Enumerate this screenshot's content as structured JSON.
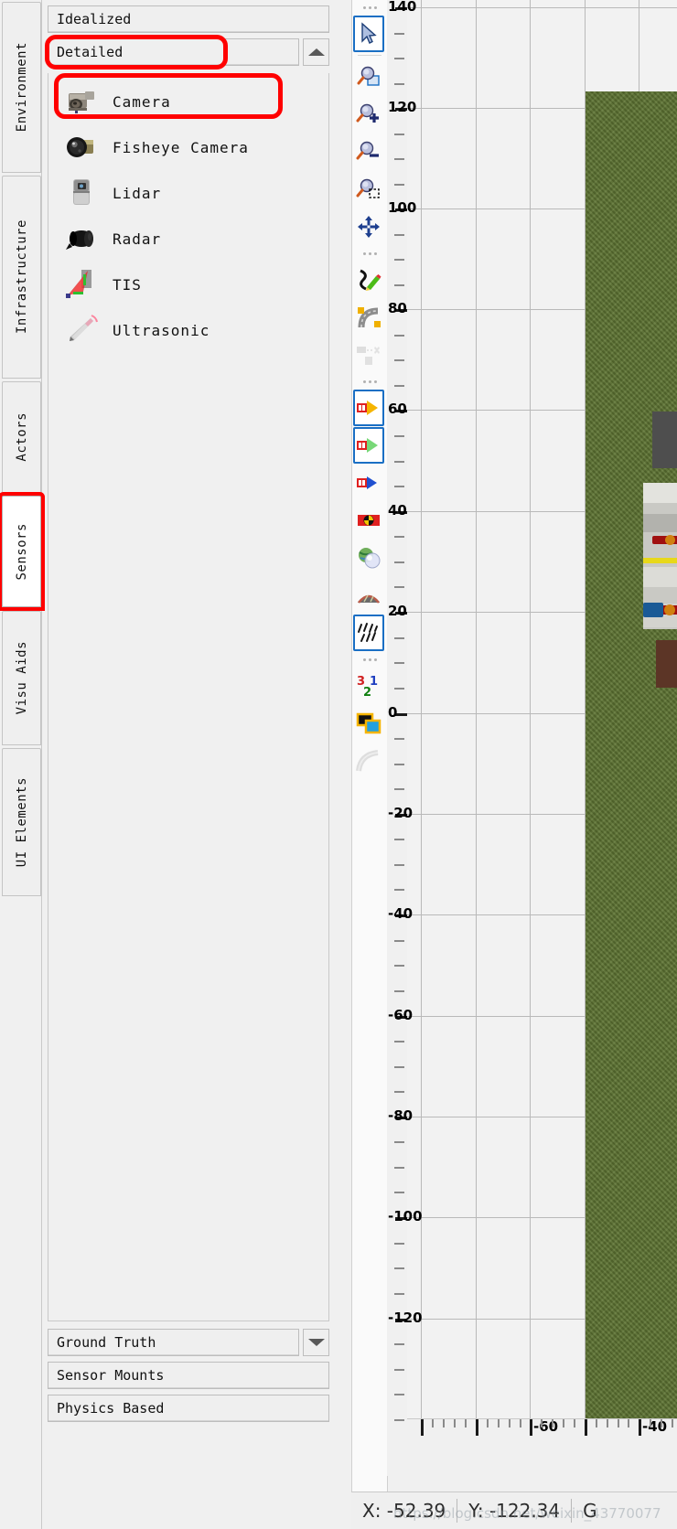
{
  "vertical_tabs": [
    {
      "label": "Environment",
      "selected": false,
      "highlighted": false
    },
    {
      "label": "Infrastructure",
      "selected": false,
      "highlighted": false
    },
    {
      "label": "Actors",
      "selected": false,
      "highlighted": false
    },
    {
      "label": "Sensors",
      "selected": true,
      "highlighted": true
    },
    {
      "label": "Visu Aids",
      "selected": false,
      "highlighted": false
    },
    {
      "label": "UI Elements",
      "selected": false,
      "highlighted": false
    }
  ],
  "panel": {
    "groups_top": [
      {
        "label": "Idealized",
        "has_arrow": false,
        "highlighted": false
      },
      {
        "label": "Detailed",
        "has_arrow": true,
        "arrow": "caret-up",
        "highlighted": true
      }
    ],
    "sensors": [
      {
        "label": "Camera",
        "icon": "camera-icon",
        "highlighted": true
      },
      {
        "label": "Fisheye Camera",
        "icon": "fisheye-camera-icon",
        "highlighted": false
      },
      {
        "label": "Lidar",
        "icon": "lidar-icon",
        "highlighted": false
      },
      {
        "label": "Radar",
        "icon": "radar-icon",
        "highlighted": false
      },
      {
        "label": "TIS",
        "icon": "tis-icon",
        "highlighted": false
      },
      {
        "label": "Ultrasonic",
        "icon": "ultrasonic-icon",
        "highlighted": false
      }
    ],
    "groups_bottom": [
      {
        "label": "Ground Truth",
        "has_arrow": true,
        "arrow": "caret-down"
      },
      {
        "label": "Sensor Mounts",
        "has_arrow": false
      },
      {
        "label": "Physics Based",
        "has_arrow": false
      }
    ]
  },
  "toolbar": {
    "groups": [
      {
        "grip": true,
        "items": [
          {
            "name": "select-cursor-tool",
            "selected": true,
            "enabled": true
          }
        ]
      },
      {
        "grip": false,
        "separator": true,
        "items": [
          {
            "name": "zoom-fit-tool",
            "selected": false,
            "enabled": true
          },
          {
            "name": "zoom-in-tool",
            "selected": false,
            "enabled": true
          },
          {
            "name": "zoom-out-tool",
            "selected": false,
            "enabled": true
          },
          {
            "name": "zoom-region-tool",
            "selected": false,
            "enabled": true
          },
          {
            "name": "pan-move-tool",
            "selected": false,
            "enabled": true
          }
        ]
      },
      {
        "grip": true,
        "items": [
          {
            "name": "draw-path-tool",
            "selected": false,
            "enabled": true
          },
          {
            "name": "road-curve-tool",
            "selected": false,
            "enabled": true
          },
          {
            "name": "object-delete-tool",
            "selected": false,
            "enabled": false
          }
        ]
      },
      {
        "grip": true,
        "items": [
          {
            "name": "sensor-frustum-yellow-toggle",
            "selected": true,
            "enabled": true
          },
          {
            "name": "sensor-frustum-green-toggle",
            "selected": true,
            "enabled": true
          },
          {
            "name": "sensor-frustum-blue-toggle",
            "selected": false,
            "enabled": true
          },
          {
            "name": "sensor-detection-toggle",
            "selected": false,
            "enabled": true
          },
          {
            "name": "environment-sphere-toggle",
            "selected": false,
            "enabled": true
          },
          {
            "name": "terrain-road-toggle",
            "selected": false,
            "enabled": true
          },
          {
            "name": "rain-effects-toggle",
            "selected": true,
            "enabled": true
          }
        ]
      },
      {
        "grip": true,
        "items": [
          {
            "name": "layer-order-tool",
            "selected": false,
            "enabled": true
          },
          {
            "name": "color-swap-tool",
            "selected": false,
            "enabled": true
          },
          {
            "name": "curve-radius-tool",
            "selected": false,
            "enabled": false
          }
        ]
      }
    ]
  },
  "canvas": {
    "y_axis_labels": [
      "140",
      "120",
      "100",
      "80",
      "60",
      "40",
      "20",
      "0",
      "-20",
      "-40",
      "-60",
      "-80",
      "-100",
      "-120"
    ],
    "x_axis_labels": [
      "-60",
      "-40"
    ],
    "grid": true
  },
  "status_bar": {
    "x_label": "X: -52.39",
    "y_label": "Y: -122.34",
    "g_label": "G",
    "watermark": "https://blog.csdn.net/weixin_43770077"
  },
  "colors": {
    "highlight_red": "#ff0000",
    "selection_blue": "#1a6fc4",
    "grass_green": "#5d7332",
    "panel_bg": "#f0f0f0"
  },
  "chart_data": {
    "type": "scatter",
    "title": "",
    "xlabel": "",
    "ylabel": "",
    "xlim": [
      -70,
      -35
    ],
    "ylim": [
      -130,
      145
    ],
    "grid": true,
    "x_ticks": [
      -60,
      -40
    ],
    "y_ticks": [
      140,
      120,
      100,
      80,
      60,
      40,
      20,
      0,
      -20,
      -40,
      -60,
      -80,
      -100,
      -120
    ],
    "annotations": [
      "X: -52.39",
      "Y: -122.34"
    ]
  }
}
